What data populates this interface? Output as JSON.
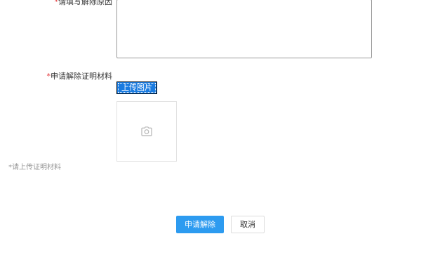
{
  "form": {
    "reason": {
      "required_mark": "*",
      "label": "请填写解除原因",
      "value": "",
      "placeholder": ""
    },
    "proof": {
      "required_mark": "*",
      "label": "申请解除证明材料",
      "upload_label": "上传图片",
      "photo_icon": "camera-icon",
      "hint_mark": "*",
      "hint": "请上传证明材料"
    }
  },
  "actions": {
    "submit_label": "申请解除",
    "cancel_label": "取消"
  },
  "colors": {
    "required": "#e4393c",
    "upload_button": "#1a7be0",
    "primary_button": "#2d9bf0",
    "hint_text": "#999999"
  }
}
